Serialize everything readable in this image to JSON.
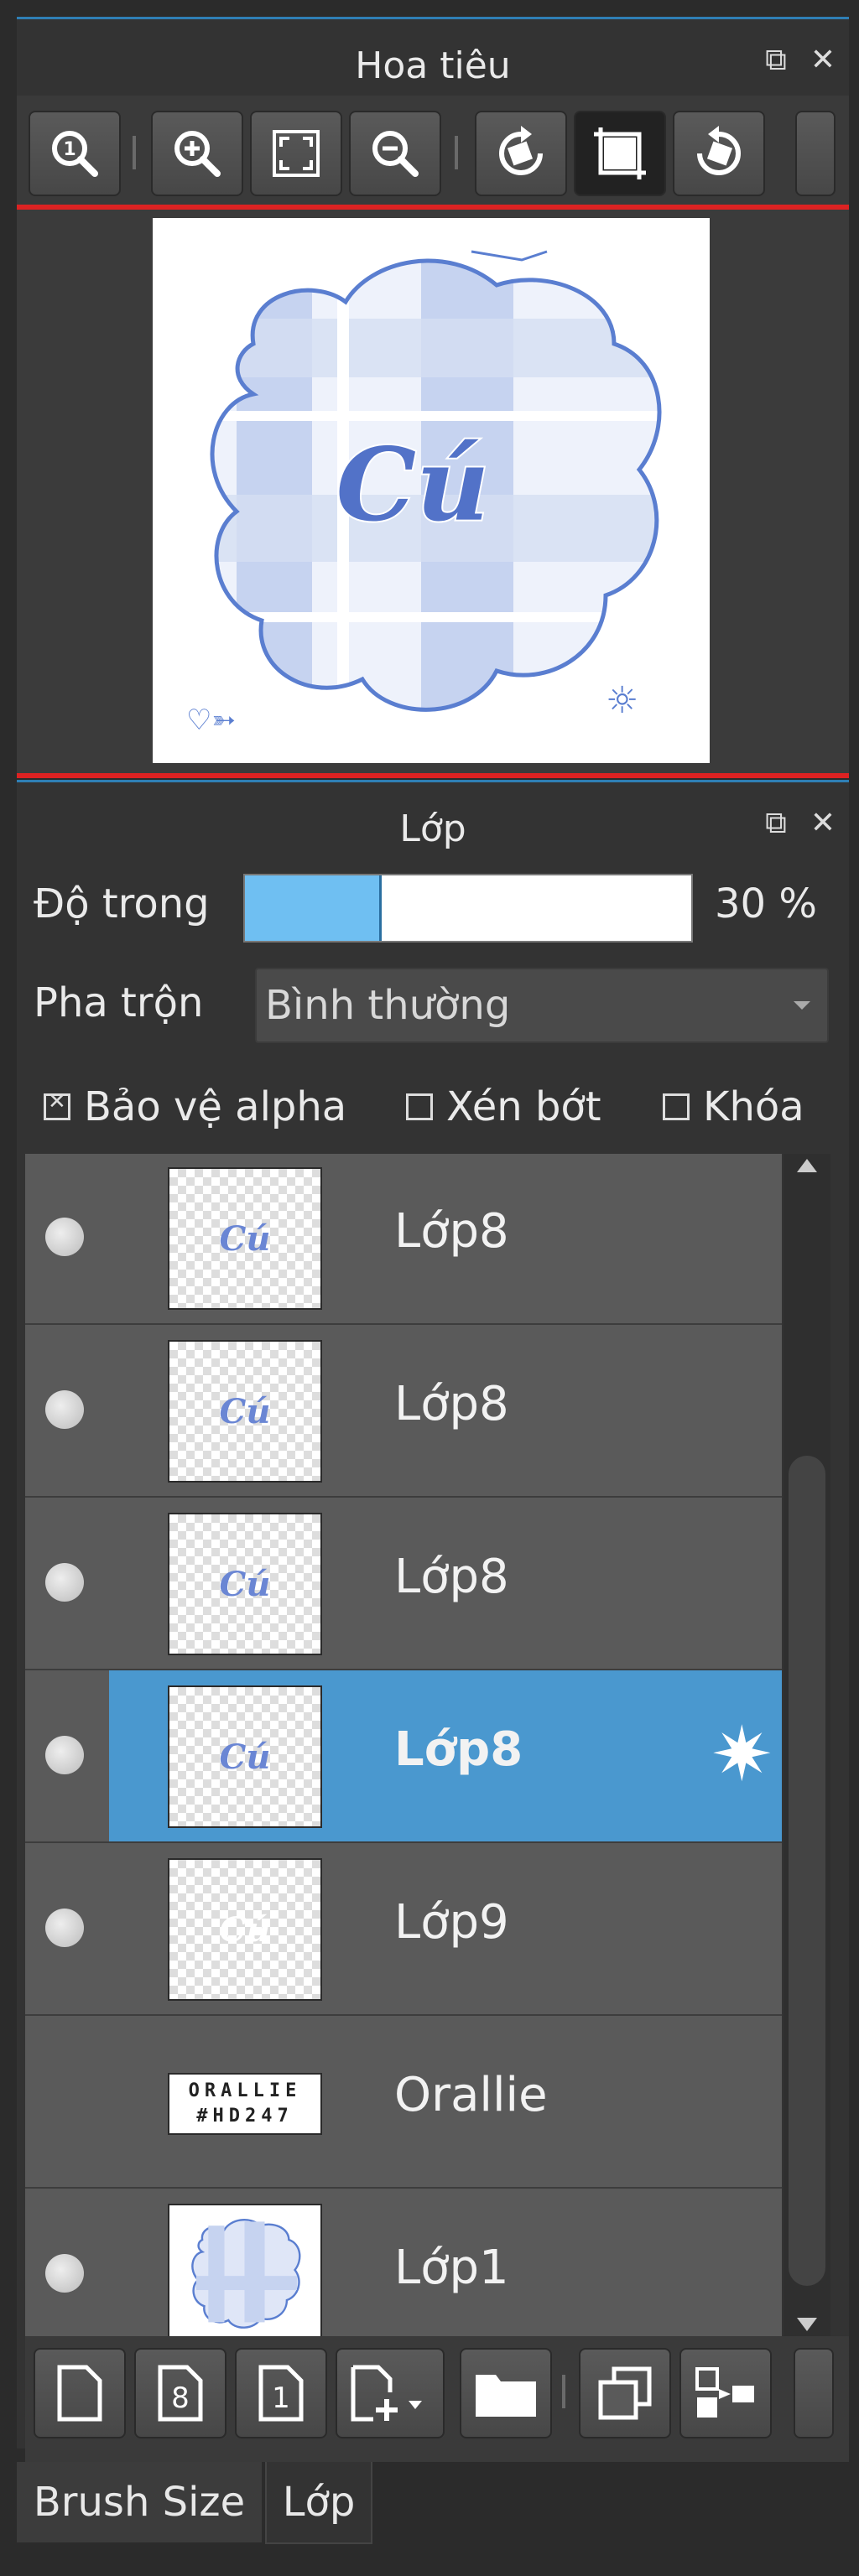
{
  "navigator": {
    "title": "Hoa tiêu",
    "detach_icon": "⧉",
    "close_icon": "✕",
    "tools": [
      {
        "name": "zoom-actual-icon"
      },
      {
        "name": "zoom-in-icon"
      },
      {
        "name": "fit-screen-icon"
      },
      {
        "name": "zoom-out-icon"
      },
      {
        "name": "rotate-left-icon"
      },
      {
        "name": "crop-icon"
      },
      {
        "name": "rotate-right-icon"
      }
    ],
    "preview_text": "Cú"
  },
  "layers_panel": {
    "title": "Lớp",
    "opacity_label": "Độ trong",
    "opacity_percent": 30,
    "opacity_text": "30 %",
    "blend_label": "Pha trộn",
    "blend_value": "Bình thường",
    "checks": [
      {
        "label": "Bảo vệ alpha",
        "checked": true
      },
      {
        "label": "Xén bớt",
        "checked": false
      },
      {
        "label": "Khóa",
        "checked": false
      }
    ],
    "layers": [
      {
        "name": "Lớp8",
        "thumb": "Cú",
        "visible": true,
        "selected": false
      },
      {
        "name": "Lớp8",
        "thumb": "Cú",
        "visible": true,
        "selected": false
      },
      {
        "name": "Lớp8",
        "thumb": "Cú",
        "visible": true,
        "selected": false
      },
      {
        "name": "Lớp8",
        "thumb": "Cú",
        "visible": true,
        "selected": true
      },
      {
        "name": "Lớp9",
        "thumb": "Cú",
        "visible": true,
        "selected": false
      },
      {
        "name": "Orallie",
        "thumb_lines": [
          "ORALLIE",
          "#HD247"
        ],
        "visible": false,
        "selected": false
      },
      {
        "name": "Lớp1",
        "thumb": "",
        "visible": true,
        "selected": false
      }
    ],
    "bottom_tools": [
      {
        "name": "new-layer-icon",
        "glyph": ""
      },
      {
        "name": "new-8bit-layer-icon",
        "glyph": "8"
      },
      {
        "name": "new-1bit-layer-icon",
        "glyph": "1"
      },
      {
        "name": "add-layer-menu-icon",
        "glyph": ""
      },
      {
        "name": "folder-icon",
        "glyph": ""
      },
      {
        "name": "duplicate-layer-icon",
        "glyph": ""
      },
      {
        "name": "merge-down-icon",
        "glyph": ""
      }
    ]
  },
  "tabs": [
    {
      "label": "Brush Size",
      "active": false
    },
    {
      "label": "Lớp",
      "active": true
    }
  ],
  "colors": {
    "accent": "#4a98cf",
    "panel": "#333333",
    "nav_border": "#dd2222"
  }
}
